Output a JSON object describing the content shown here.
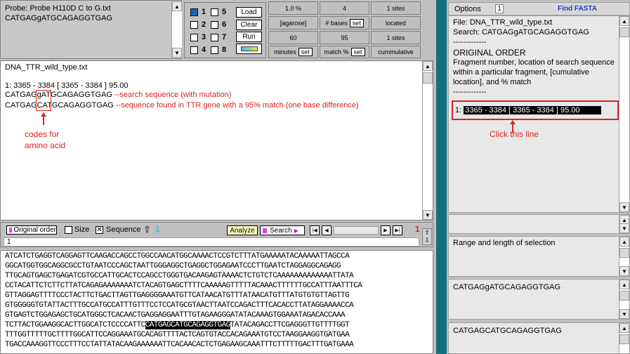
{
  "probe": {
    "title": "Probe: Probe  H110D C to G.txt",
    "sequence": "CATGAGgATGCAGAGGTGAG"
  },
  "controls": {
    "lanes": [
      "1",
      "5",
      "2",
      "6",
      "3",
      "7",
      "4",
      "8"
    ],
    "load": "Load",
    "clear": "Clear",
    "run": "Run"
  },
  "params": {
    "agarose_value": "1.0 %",
    "agarose_label": "[agarose]",
    "minutes_value": "60",
    "minutes_label": "minutes",
    "minutes_set": "set",
    "bases_value": "4",
    "bases_label": "# bases",
    "bases_set": "set",
    "match_value": "95",
    "match_label": "match %",
    "match_set": "set",
    "sites1_value": "1 sites",
    "located_label": "located",
    "sites2_value": "1 sites",
    "cumulative_label": "cummulative"
  },
  "results": {
    "file": "DNA_TTR_wild_type.txt",
    "hit": "1: 3365 - 3384 [ 3365 - 3384 ]  95.00",
    "seq_search_a": "CATGAG",
    "seq_search_b": "gAT",
    "seq_search_c": "GCAGAGGTGAG",
    "seq_search_note": "--search sequence (with mutation)",
    "seq_found_a": "CATGAG",
    "seq_found_b": "CAT",
    "seq_found_c": "GCAGAGGTGAG",
    "seq_found_note": "--sequence found in TTR gene with a 95% match (one base difference)",
    "codon_note_1": "codes for",
    "codon_note_2": "amino acid"
  },
  "toolbar": {
    "original_order": "Original order",
    "size": "Size",
    "sequence": "Sequence",
    "analyze": "Analyze",
    "search": "Search",
    "counter": "1",
    "row_num": "1"
  },
  "dna": {
    "lines": [
      "ATCATCTGAGGTCAGGAGTTCAAGACCAGCCTGGCCAACATGGCAAAACTCCGTCTTTATGAAAAATACAAAAATTAGCCA",
      "GGCATGGTGGCAGGCGCCTGTAATCCCAGCTAATTGGGAGGCTGAGGCTGGAGAATCCCTTGAATCTAGGAGGCAGAGG",
      "TTGCAGTGAGCTGAGATCGTGCCATTGCACTCCAGCCTGGGTGACAAGAGTAAAACTCTGTCTCAAAAAAAAAAAAATTATA",
      "CCTACATTCTCTTCTTATCAGAGAAAAAAATCTACAGTGAGCTTTTCAAAAAGTTTTTACAAACTTTTTTGCCATTTAATTTCA",
      "GTTAGGAGTTTTCCCTACTTCTGACTTAGTTGAGGGGAAATGTTCATAACATGTTTATAACATGTTTATGTGTGTTAGTTG",
      "GTGGGGGTGTATTACTTTGCCATGCCATTTGTTTCCTCCATGCGTAACTTAATCCAGACTTTCACACCTTATAGGAAAACCA",
      "GTGAGTCTGGAGAGCTGCATGGGCTCACAACTGAGGAGGAATTTGTAGAAGGGATATACAAAGTGGAAATAGACACCAAA",
      "TCTTACTGGAAGGCACTTGGCATCTCCCCATTC",
      "TTTGGTTTTTGCTTTTGGCATTCCAGGAAATGCACAGTTTTACTCAGTGTACCACAGAAATGTCCTAAGGAAGGTGATGAA",
      "TGACCAAAGGTTCCCTTTCCTATTATACAAGAAAAAATTCACAACACTCTGAGAAGCAAATTTCTTTTTGACTTTGATGAAA"
    ],
    "highlight": "CATGAGCATGCAGAGGTGAG",
    "after_highlight": "TATACAGACCTTCGAGGGTTGTTTTGGT"
  },
  "right": {
    "options": "Options",
    "options_val": "1",
    "find_fasta": "Find FASTA",
    "file_line": "File:  DNA_TTR_wild_type.txt",
    "search_line": "Search:  CATGAGgATGCAGAGGTGAG",
    "dash1": "-------------",
    "orig_order": "ORIGINAL ORDER",
    "desc1": "Fragment number, location of search sequence",
    "desc2": "within a particular fragment, [cumulative",
    "desc3": "location], and % match",
    "dash2": "-------------",
    "hit_num": "1:",
    "hit_sel": "3365 - 3384 [ 3365 - 3384 ]  95.00",
    "click_note": "Click this line",
    "range_label": "Range and length of selection",
    "seq_a": "CATGAGgATGCAGAGGTGAG",
    "seq_b": "CATGAGCATGCAGAGGTGAG"
  }
}
